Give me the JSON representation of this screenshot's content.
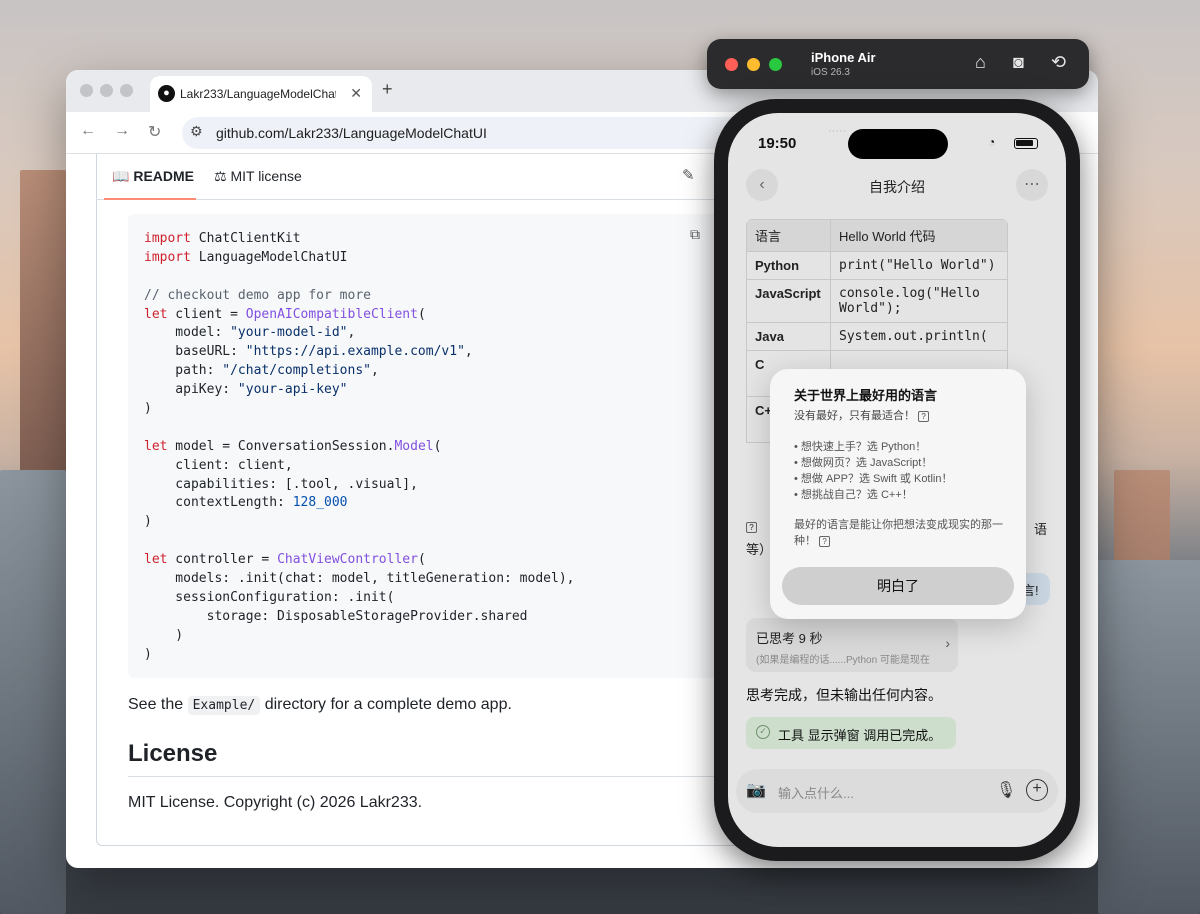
{
  "browser": {
    "tab_title": "Lakr233/LanguageModelChatUI",
    "tab_icon": "github-icon",
    "address": "github.com/Lakr233/LanguageModelChatUI",
    "readme_tab": "README",
    "license_tab": "MIT license",
    "code_lines": [
      [
        [
          "kw",
          "import"
        ],
        [
          "p",
          " ChatClientKit"
        ]
      ],
      [
        [
          "kw",
          "import"
        ],
        [
          "p",
          " LanguageModelChatUI"
        ]
      ],
      [],
      [
        [
          "cm",
          "// checkout demo app for more"
        ]
      ],
      [
        [
          "kw",
          "let"
        ],
        [
          "p",
          " client = "
        ],
        [
          "fn",
          "OpenAICompatibleClient"
        ],
        [
          "p",
          "("
        ]
      ],
      [
        [
          "p",
          "    model: "
        ],
        [
          "str",
          "\"your-model-id\""
        ],
        [
          "p",
          ","
        ]
      ],
      [
        [
          "p",
          "    baseURL: "
        ],
        [
          "str",
          "\"https://api.example.com/v1\""
        ],
        [
          "p",
          ","
        ]
      ],
      [
        [
          "p",
          "    path: "
        ],
        [
          "str",
          "\"/chat/completions\""
        ],
        [
          "p",
          ","
        ]
      ],
      [
        [
          "p",
          "    apiKey: "
        ],
        [
          "str",
          "\"your-api-key\""
        ]
      ],
      [
        [
          "p",
          ")"
        ]
      ],
      [],
      [
        [
          "kw",
          "let"
        ],
        [
          "p",
          " model = ConversationSession."
        ],
        [
          "fn",
          "Model"
        ],
        [
          "p",
          "("
        ]
      ],
      [
        [
          "p",
          "    client: client,"
        ]
      ],
      [
        [
          "p",
          "    capabilities: [.tool, .visual],"
        ]
      ],
      [
        [
          "p",
          "    contextLength: "
        ],
        [
          "num",
          "128_000"
        ]
      ],
      [
        [
          "p",
          ")"
        ]
      ],
      [],
      [
        [
          "kw",
          "let"
        ],
        [
          "p",
          " controller = "
        ],
        [
          "fn",
          "ChatViewController"
        ],
        [
          "p",
          "("
        ]
      ],
      [
        [
          "p",
          "    models: .init(chat: model, titleGeneration: model),"
        ]
      ],
      [
        [
          "p",
          "    sessionConfiguration: .init("
        ]
      ],
      [
        [
          "p",
          "        storage: DisposableStorageProvider.shared"
        ]
      ],
      [
        [
          "p",
          "    )"
        ]
      ],
      [
        [
          "p",
          ")"
        ]
      ]
    ],
    "see_prefix": "See the",
    "see_code": "Example/",
    "see_suffix": "directory for a complete demo app.",
    "license_heading": "License",
    "license_text": "MIT License. Copyright (c) 2026 Lakr233."
  },
  "simulator": {
    "device": "iPhone Air",
    "os": "iOS 26.3"
  },
  "phone": {
    "time": "19:50",
    "title": "自我介绍",
    "table": {
      "headers": [
        "语言",
        "Hello World 代码"
      ],
      "rows": [
        [
          "Python",
          "print(\"Hello World\")"
        ],
        [
          "JavaScript",
          "console.log(\"Hello World\");"
        ],
        [
          "Java",
          "System.out.println("
        ],
        [
          "C",
          ""
        ],
        [
          "C+",
          ""
        ]
      ]
    },
    "fragment_left": "等）",
    "fragment_right1": "语",
    "fragment_right2": "言!",
    "thinking_title": "已思考 9 秒",
    "thinking_preview": "(如果是编程的话......Python 可能是现在",
    "done_text": "思考完成，但未输出任何内容。",
    "tool_text": "工具 显示弹窗 调用已完成。",
    "input_placeholder": "输入点什么...",
    "dialog": {
      "title": "关于世界上最好用的语言",
      "subtitle": "没有最好，只有最适合！",
      "items": [
        "• 想快速上手？选 Python！",
        "• 想做网页？选 JavaScript！",
        "• 想做 APP？选 Swift 或 Kotlin！",
        "• 想挑战自己？选 C++！"
      ],
      "footer": "最好的语言是能让你把想法变成现实的那一种！",
      "button": "明白了"
    }
  },
  "colors": {
    "keyword": "#cf222e",
    "function": "#8250df",
    "string": "#0a3069",
    "number": "#0550ae",
    "tab_underline": "#fd8c73"
  }
}
